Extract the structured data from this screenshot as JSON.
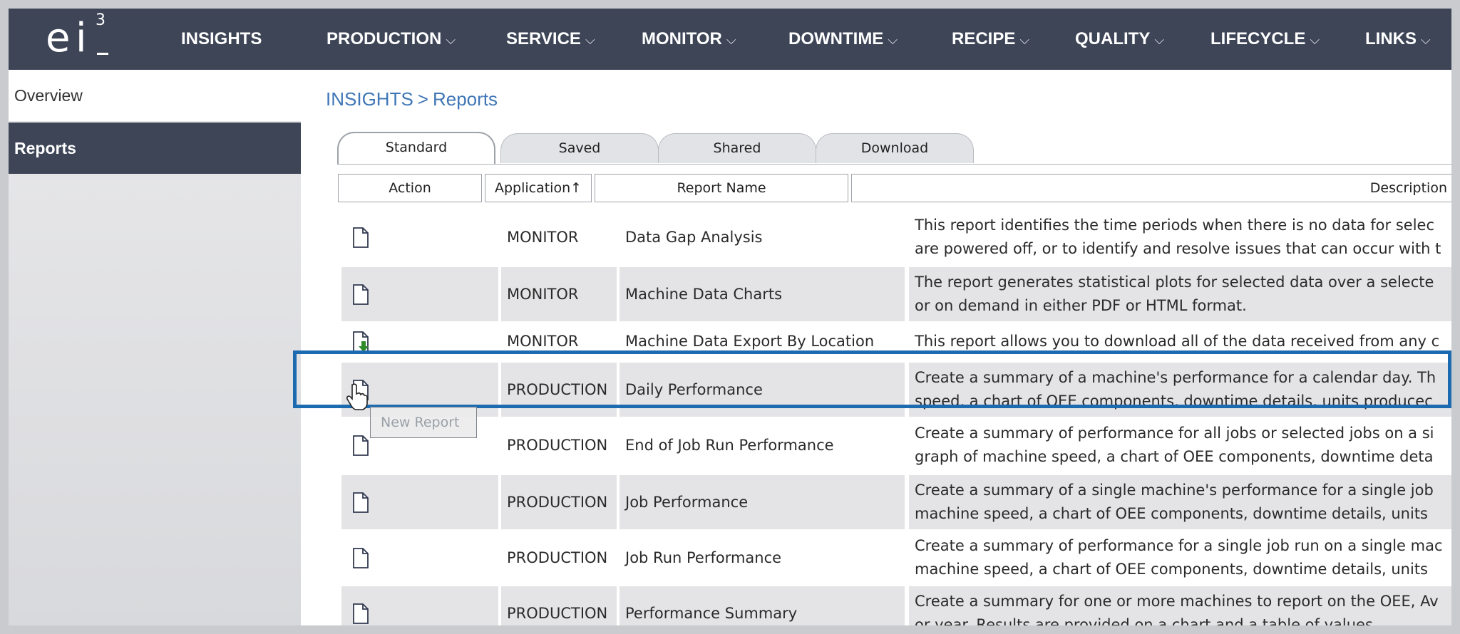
{
  "logo": {
    "letters": "ei",
    "superscript": "3"
  },
  "nav": [
    {
      "label": "INSIGHTS",
      "chevron": false
    },
    {
      "label": "PRODUCTION",
      "chevron": true
    },
    {
      "label": "SERVICE",
      "chevron": true
    },
    {
      "label": "MONITOR",
      "chevron": true
    },
    {
      "label": "DOWNTIME",
      "chevron": true
    },
    {
      "label": "RECIPE",
      "chevron": true
    },
    {
      "label": "QUALITY",
      "chevron": true
    },
    {
      "label": "LIFECYCLE",
      "chevron": true
    },
    {
      "label": "LINKS",
      "chevron": true
    }
  ],
  "sidebar": {
    "items": [
      {
        "label": "Overview"
      },
      {
        "label": "Reports"
      }
    ]
  },
  "breadcrumb": {
    "root": "INSIGHTS",
    "separator": ">",
    "current": "Reports"
  },
  "tabs": [
    {
      "label": "Standard"
    },
    {
      "label": "Saved"
    },
    {
      "label": "Shared"
    },
    {
      "label": "Download"
    }
  ],
  "table": {
    "headers": {
      "action": "Action",
      "application": "Application↑",
      "report_name": "Report Name",
      "description": "Description"
    },
    "rows": [
      {
        "icon": "new-report-icon",
        "application": "MONITOR",
        "name": "Data Gap Analysis",
        "description": "This report identifies the time periods when there is no data for selec are powered off, or to identify and resolve issues that can occur with t"
      },
      {
        "icon": "new-report-icon",
        "application": "MONITOR",
        "name": "Machine Data Charts",
        "description": "The report generates statistical plots for selected data over a selecte or on demand in either PDF or HTML format."
      },
      {
        "icon": "download-report-icon",
        "application": "MONITOR",
        "name": "Machine Data Export By Location",
        "description": "This report allows you to download all of the data received from any c"
      },
      {
        "icon": "new-report-icon",
        "application": "PRODUCTION",
        "name": "Daily Performance",
        "description": "Create a summary of a machine's performance for a calendar day. Th speed, a chart of OEE components, downtime details, units producec"
      },
      {
        "icon": "new-report-icon",
        "application": "PRODUCTION",
        "name": "End of Job Run Performance",
        "description": "Create a summary of performance for all jobs or selected jobs on a si graph of machine speed, a chart of OEE components, downtime deta"
      },
      {
        "icon": "new-report-icon",
        "application": "PRODUCTION",
        "name": "Job Performance",
        "description": "Create a summary of a single machine's performance for a single job machine speed, a chart of OEE components, downtime details, units"
      },
      {
        "icon": "new-report-icon",
        "application": "PRODUCTION",
        "name": "Job Run Performance",
        "description": "Create a summary of performance for a single job run on a single mac machine speed, a chart of OEE components, downtime details, units"
      },
      {
        "icon": "new-report-icon",
        "application": "PRODUCTION",
        "name": "Performance Summary",
        "description": "Create a summary for one or more machines to report on the OEE, Av or year. Results are provided on a chart and a table of values."
      }
    ]
  },
  "tooltip": {
    "text": "New Report"
  },
  "colors": {
    "nav_bg": "#3d4557",
    "link": "#3f76b6",
    "highlight": "#1c6bb0"
  }
}
